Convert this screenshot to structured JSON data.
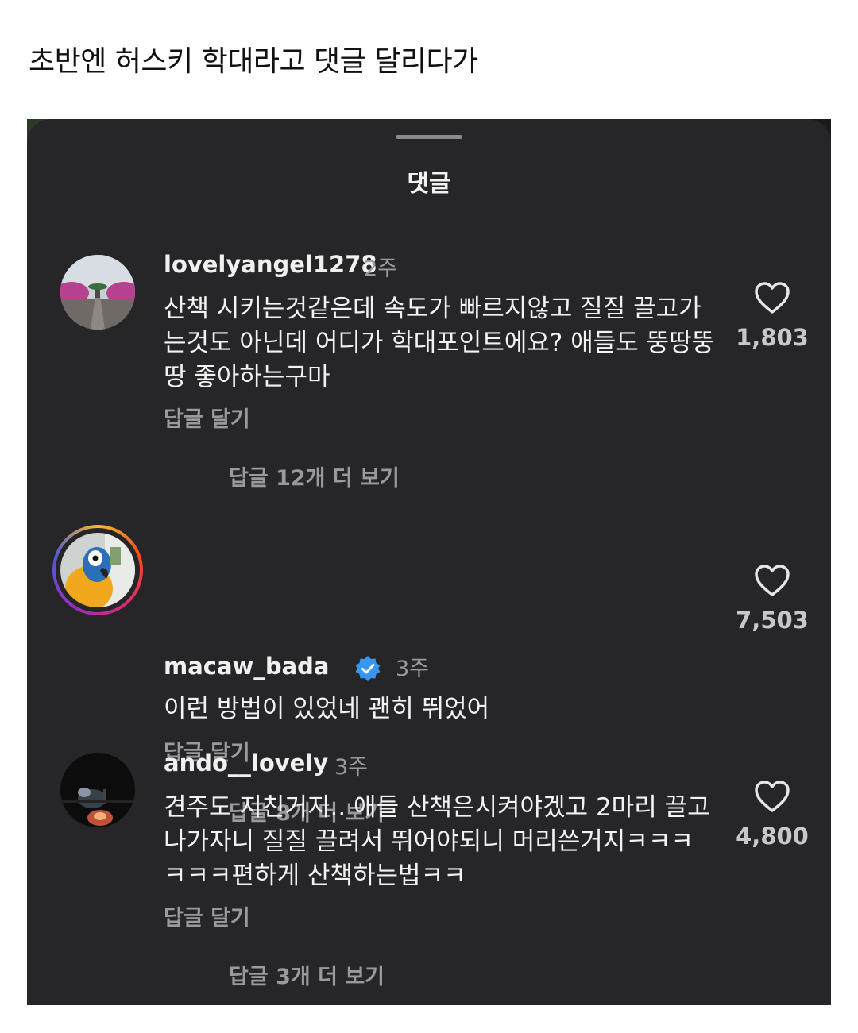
{
  "post": {
    "caption": "초반엔 허스키 학대라고 댓글 달리다가"
  },
  "sheet": {
    "title": "댓글"
  },
  "comments": [
    {
      "username": "lovelyangel1278",
      "time": "2주",
      "verified": false,
      "text": "산책 시키는것같은데  속도가 빠르지않고  질질 끌고가는것도 아닌데 어디가 학대포인트에요? 애들도 뚱땅뚱땅 좋아하는구마",
      "reply_label": "답글 달기",
      "more_replies": "답글 12개 더 보기",
      "likes": "1,803"
    },
    {
      "username": "macaw_bada",
      "time": "3주",
      "verified": true,
      "text": "이런 방법이 있었네 괜히 뛰었어",
      "reply_label": "답글 달기",
      "more_replies": "답글 8개 더 보기",
      "likes": "7,503"
    },
    {
      "username": "ando__lovely",
      "time": "3주",
      "verified": false,
      "text": "견주도 지친거지.. 애들 산책은시켜야겠고 2마리 끌고나가자니 질질 끌려서 뛰어야되니 머리쓴거지ㅋㅋㅋㅋㅋㅋ편하게 산책하는법ㅋㅋ",
      "reply_label": "답글 달기",
      "more_replies": "답글 3개 더 보기",
      "likes": "4,800"
    }
  ],
  "icons": {
    "like": "heart-outline-icon",
    "verified": "verified-badge-icon",
    "handle": "drag-handle"
  },
  "colors": {
    "sheet_bg": "#262629",
    "verified_blue": "#3897f0",
    "muted_text": "#9a9a9e"
  }
}
